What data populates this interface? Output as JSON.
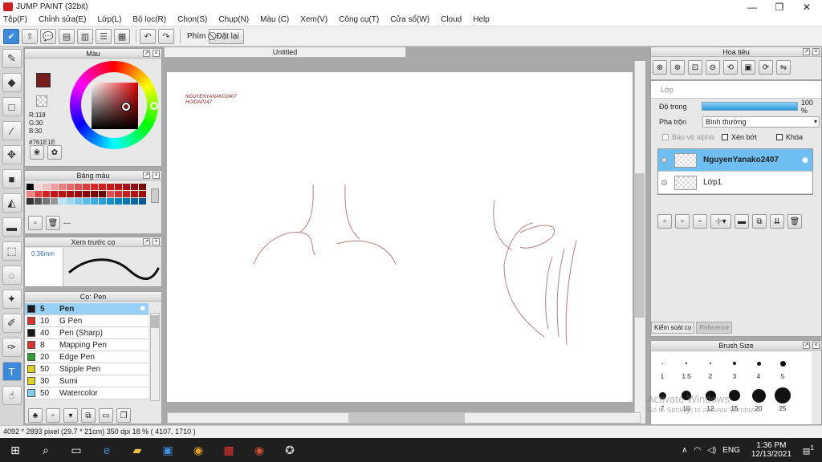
{
  "window": {
    "title": "JUMP PAINT (32bit)",
    "minimize": "—",
    "restore": "❐",
    "close": "✕"
  },
  "menu": [
    "Tệp(F)",
    "Chỉnh sửa(E)",
    "Lớp(L)",
    "Bộ lọc(R)",
    "Chọn(S)",
    "Chụp(N)",
    "Màu (C)",
    "Xem(V)",
    "Công cụ(T)",
    "Cửa sổ(W)",
    "Cloud",
    "Help"
  ],
  "toolbar": {
    "shortcut_label": "Phím",
    "reset_label": "Đặt lại"
  },
  "color_panel": {
    "title": "Màu",
    "r": "R:118",
    "g": "G:30",
    "b": "B:30",
    "hex": "#761E1E",
    "main_color": "#761e1e"
  },
  "swatch_panel": {
    "title": "Bảng màu",
    "extra": "---"
  },
  "preview_panel": {
    "title": "Xem trước cọ",
    "size": "0.36mm"
  },
  "brush_panel": {
    "title": "Cọ: Pen",
    "items": [
      {
        "size": "5",
        "name": "Pen",
        "color": "#1a1a1a",
        "selected": true
      },
      {
        "size": "10",
        "name": "G Pen",
        "color": "#e03030"
      },
      {
        "size": "40",
        "name": "Pen (Sharp)",
        "color": "#1a1a1a"
      },
      {
        "size": "8",
        "name": "Mapping Pen",
        "color": "#e03030"
      },
      {
        "size": "20",
        "name": "Edge Pen",
        "color": "#2aa02a"
      },
      {
        "size": "50",
        "name": "Stipple Pen",
        "color": "#e0d020"
      },
      {
        "size": "30",
        "name": "Sumi",
        "color": "#e0d020"
      },
      {
        "size": "50",
        "name": "Watercolor",
        "color": "#7fd0f0"
      }
    ]
  },
  "document": {
    "tab": "Untitled",
    "signature_line1": "NGUYENYANAKO2407",
    "signature_line2": "HOIDAP247"
  },
  "navigator": {
    "title": "Hoa tiêu"
  },
  "layer_panel": {
    "title": "Lớp",
    "opacity_label": "Độ trong",
    "opacity_value": "100 %",
    "opacity_fraction": 1.0,
    "blend_label": "Pha trộn",
    "blend_value": "Bình thường",
    "protect_alpha": "Bảo vệ alpha",
    "clipping": "Xén bớt",
    "lock": "Khóa",
    "layers": [
      {
        "name": "NguyenYanako2407",
        "selected": true
      },
      {
        "name": "Lớp1",
        "selected": false
      }
    ],
    "tab_check": "Kiểm soát cọ",
    "tab_reference": "Reference"
  },
  "brush_size_panel": {
    "title": "Brush Size",
    "sizes": [
      "1",
      "1.5",
      "2",
      "3",
      "4",
      "5",
      "7",
      "10",
      "12",
      "15",
      "20",
      "25"
    ]
  },
  "status": {
    "text": "4092 * 2893 pixel   (29.7 * 21cm)   350 dpi   18 %   ( 4107, 1710 )"
  },
  "watermark": {
    "line1": "Activate Windows",
    "line2": "Go to Settings to activate Windows."
  },
  "taskbar": {
    "lang": "ENG",
    "time": "1:36 PM",
    "date": "12/13/2021",
    "notifications": "1"
  }
}
